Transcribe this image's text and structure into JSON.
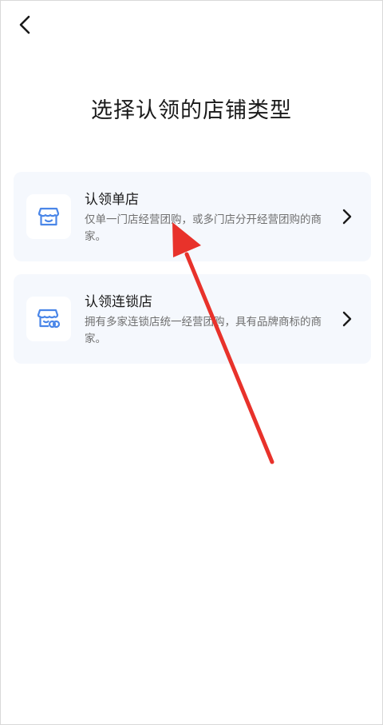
{
  "header": {
    "back_icon": "chevron-left-icon"
  },
  "page": {
    "title": "选择认领的店铺类型"
  },
  "options": [
    {
      "title": "认领单店",
      "description": "仅单一门店经营团购，或多门店分开经营团购的商家。",
      "icon": "storefront-icon"
    },
    {
      "title": "认领连锁店",
      "description": "拥有多家连锁店统一经营团购，具有品牌商标的商家。",
      "icon": "chain-store-icon"
    }
  ],
  "colors": {
    "accent_blue": "#4a86e8",
    "card_bg": "#f5f8fd",
    "annotation_red": "#e8322b"
  }
}
